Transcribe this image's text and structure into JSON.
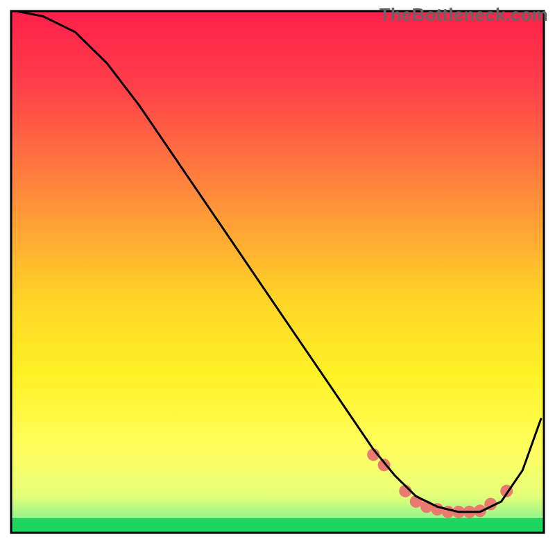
{
  "watermark": "TheBottleneck.com",
  "chart_data": {
    "type": "line",
    "title": "",
    "xlabel": "",
    "ylabel": "",
    "xlim": [
      0,
      100
    ],
    "ylim": [
      0,
      100
    ],
    "grid": false,
    "legend": false,
    "notes": "Black curve over vertical rainbow gradient background (red top → green bottom). Thin green band at very bottom. Salmon-pink dots clustered near curve minimum. No axis ticks or labels visible.",
    "gradient_stops": [
      {
        "offset": 0,
        "color": "#ff1f4a"
      },
      {
        "offset": 15,
        "color": "#ff4149"
      },
      {
        "offset": 35,
        "color": "#ff8b3c"
      },
      {
        "offset": 55,
        "color": "#ffd427"
      },
      {
        "offset": 70,
        "color": "#fff226"
      },
      {
        "offset": 85,
        "color": "#ffff62"
      },
      {
        "offset": 93,
        "color": "#e4ff7a"
      },
      {
        "offset": 97,
        "color": "#98f58a"
      },
      {
        "offset": 100,
        "color": "#1dd65f"
      }
    ],
    "series": [
      {
        "name": "curve",
        "stroke": "#000000",
        "x": [
          1,
          6,
          12,
          18,
          24,
          30,
          36,
          42,
          48,
          54,
          60,
          64,
          68,
          72,
          76,
          80,
          84,
          88,
          92,
          96,
          99.5
        ],
        "values": [
          100,
          99,
          96,
          90,
          82,
          73,
          64,
          55,
          46,
          37,
          28,
          22,
          16,
          11,
          7,
          5,
          4,
          4,
          6,
          12,
          22
        ]
      }
    ],
    "markers": {
      "color": "#e97a6f",
      "radius_px": 9,
      "x": [
        68,
        70,
        74,
        76,
        78,
        80,
        82,
        84,
        86,
        88,
        90,
        93
      ],
      "values": [
        15,
        13,
        8,
        6,
        5,
        4.5,
        4,
        4,
        4,
        4.2,
        5.5,
        8
      ]
    },
    "frame": {
      "x": 2,
      "y": 4,
      "width": 96,
      "height": 94,
      "stroke": "#000000"
    }
  }
}
